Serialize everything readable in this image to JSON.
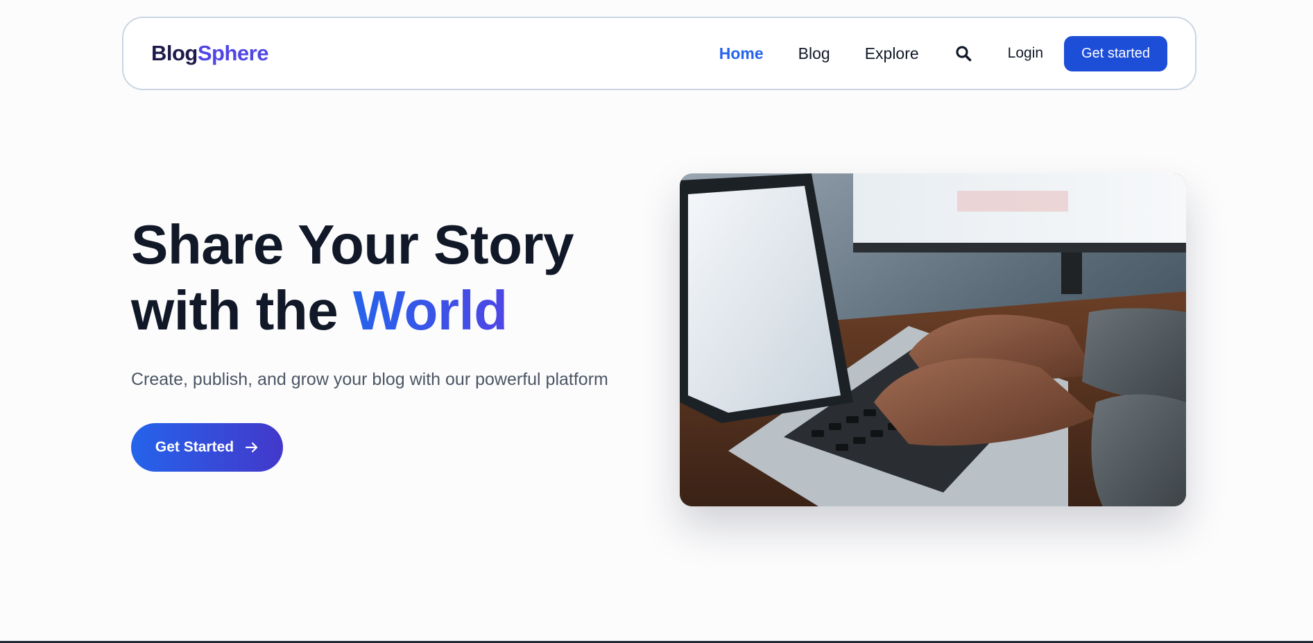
{
  "brand": {
    "part1": "Blog",
    "part2": "Sphere"
  },
  "nav": {
    "links": [
      {
        "label": "Home",
        "active": true
      },
      {
        "label": "Blog",
        "active": false
      },
      {
        "label": "Explore",
        "active": false
      }
    ],
    "search_icon": "search-icon",
    "login_label": "Login",
    "cta_label": "Get started"
  },
  "hero": {
    "title_line1": "Share Your Story",
    "title_line2_prefix": "with the ",
    "title_line2_accent": "World",
    "subtitle": "Create, publish, and grow your blog with our powerful platform",
    "cta_label": "Get Started",
    "cta_icon": "arrow-right-icon",
    "image_subject": "person typing on laptop"
  },
  "colors": {
    "accent": "#2563eb",
    "accent_secondary": "#4f46e5",
    "brand_dark": "#1e1b4b",
    "text": "#111827",
    "muted": "#4b5563"
  }
}
